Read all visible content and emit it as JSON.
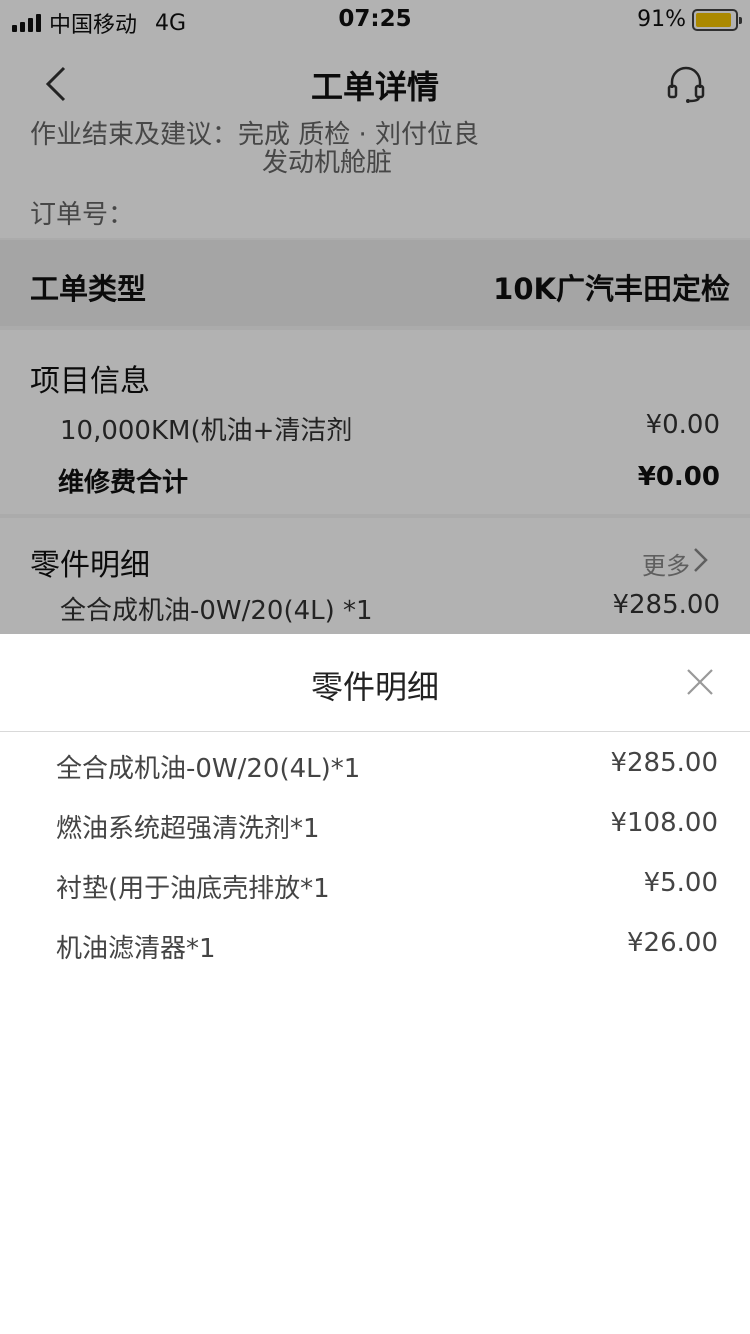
{
  "status_bar": {
    "carrier": "中国移动",
    "network": "4G",
    "time": "07:25",
    "battery": "91%",
    "battery_level": 0.91,
    "battery_color": "#f5c400"
  },
  "nav": {
    "title": "工单详情",
    "back_icon": "chevron-left-icon",
    "service_icon": "headset-icon"
  },
  "advice": {
    "line1": "作业结束及建议：完成 质检 · 刘付位良",
    "line2": "发动机舱脏"
  },
  "order": {
    "label": "订单号："
  },
  "work_order_type": {
    "label": "工单类型",
    "value": "10K广汽丰田定检"
  },
  "project_info": {
    "title": "项目信息",
    "items": [
      {
        "name": "10,000KM(机油+清洁剂",
        "price": "¥0.00"
      }
    ],
    "total_label": "维修费合计",
    "total_value": "¥0.00"
  },
  "parts_detail": {
    "title": "零件明细",
    "more_label": "更多",
    "first_item": {
      "name": "全合成机油-0W/20(4L) *1",
      "price": "¥285.00"
    }
  },
  "sheet": {
    "title": "零件明细",
    "close_icon": "close-icon",
    "items": [
      {
        "name": "全合成机油-0W/20(4L)*1",
        "price": "¥285.00"
      },
      {
        "name": "燃油系统超强清洗剂*1",
        "price": "¥108.00"
      },
      {
        "name": "衬垫(用于油底壳排放*1",
        "price": "¥5.00"
      },
      {
        "name": "机油滤清器*1",
        "price": "¥26.00"
      }
    ]
  }
}
